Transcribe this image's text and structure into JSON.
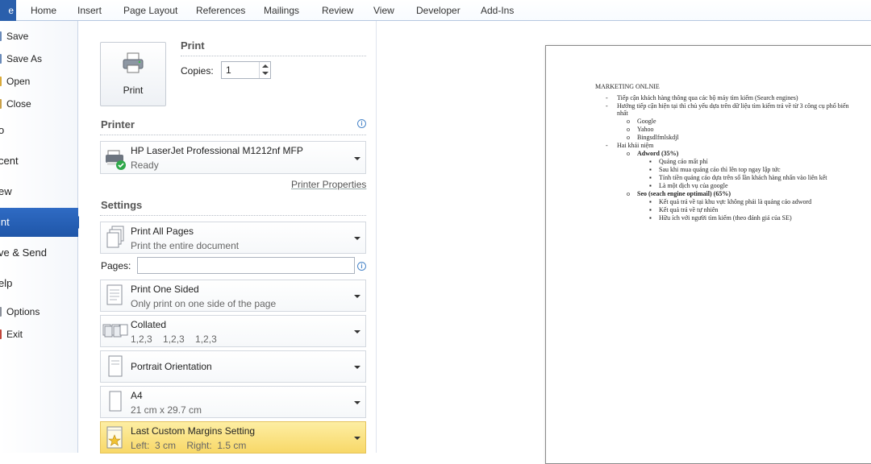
{
  "ribbon": {
    "file_tab": "e",
    "tabs": [
      "Home",
      "Insert",
      "Page Layout",
      "References",
      "Mailings",
      "Review",
      "View",
      "Developer",
      "Add-Ins"
    ]
  },
  "nav": {
    "save": "Save",
    "save_as": "Save As",
    "open": "Open",
    "close": "Close",
    "info": "o",
    "recent": "cent",
    "new": "ew",
    "print": "int",
    "save_send": "ve & Send",
    "help": "elp",
    "options": "Options",
    "exit": "Exit"
  },
  "print": {
    "button_label": "Print",
    "section_title": "Print",
    "copies_label": "Copies:",
    "copies_value": "1"
  },
  "printer": {
    "section_title": "Printer",
    "name": "HP LaserJet Professional M1212nf MFP",
    "status": "Ready",
    "properties_link": "Printer Properties"
  },
  "settings": {
    "section_title": "Settings",
    "pages_label": "Pages:",
    "pages_value": "",
    "print_range": {
      "main": "Print All Pages",
      "sub": "Print the entire document"
    },
    "sides": {
      "main": "Print One Sided",
      "sub": "Only print on one side of the page"
    },
    "collation": {
      "main": "Collated",
      "sub": "1,2,3    1,2,3    1,2,3"
    },
    "orientation": {
      "main": "Portrait Orientation"
    },
    "paper": {
      "main": "A4",
      "sub": "21 cm x 29.7 cm"
    },
    "margins": {
      "main": "Last Custom Margins Setting",
      "sub": "Left:  3 cm    Right:  1.5 cm"
    }
  },
  "document": {
    "title": "MARKETING ONLNIE",
    "lines": [
      "Tiếp cận khách hàng thông qua các bộ máy tìm kiếm (Search engines)",
      "Hướng tiếp cận hiện tại thì chủ yếu dựa trên dữ liệu tìm kiếm trả về từ 3 công cụ phổ biến",
      "nhất",
      "Google",
      "Yahoo",
      "Bingsdlfmlskdjl",
      "Hai khái niệm",
      "Adword  (35%)",
      "Quảng cáo mất phí",
      "Sau khi mua quảng cáo thì lên top ngay lập tức",
      "Tính tiền quảng cáo dựa trên số lần khách hàng nhấn vào liên kết",
      "Là một dịch vụ của google",
      "Seo (seach engine optimail) (65%)",
      "Kết quả trả về tại khu vực không phải là quảng cáo adword",
      "Kết quả trả về tự nhiên",
      "Hữu ích với người tìm kiếm (theo đánh giá của SE)"
    ]
  },
  "colors": {
    "file_tab": "#2a5fac",
    "nav_active": "#2560b4",
    "highlight": "#f9dd74",
    "link": "#555555"
  }
}
